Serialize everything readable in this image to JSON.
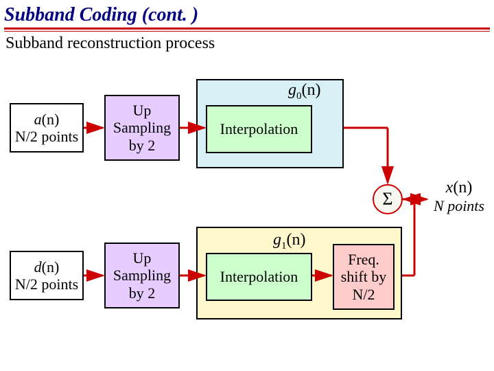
{
  "title": "Subband Coding (cont. )",
  "subtitle": "Subband reconstruction process",
  "input_a": {
    "var": "a",
    "arg": "(n)",
    "subline": "N/2 points"
  },
  "input_d": {
    "var": "d",
    "arg": "(n)",
    "subline": "N/2 points"
  },
  "upsamp": {
    "l1": "Up",
    "l2": "Sampling",
    "l3": "by 2"
  },
  "interp": "Interpolation",
  "freq": {
    "l1": "Freq.",
    "l2": "shift by",
    "l3": "N/2"
  },
  "g0": {
    "g": "g",
    "sub": "0",
    "arg": "(n)"
  },
  "g1": {
    "g": "g",
    "sub": "1",
    "arg": "(n)"
  },
  "sum": "Σ",
  "output": {
    "var": "x",
    "arg": "(n)",
    "subline": "N points"
  }
}
